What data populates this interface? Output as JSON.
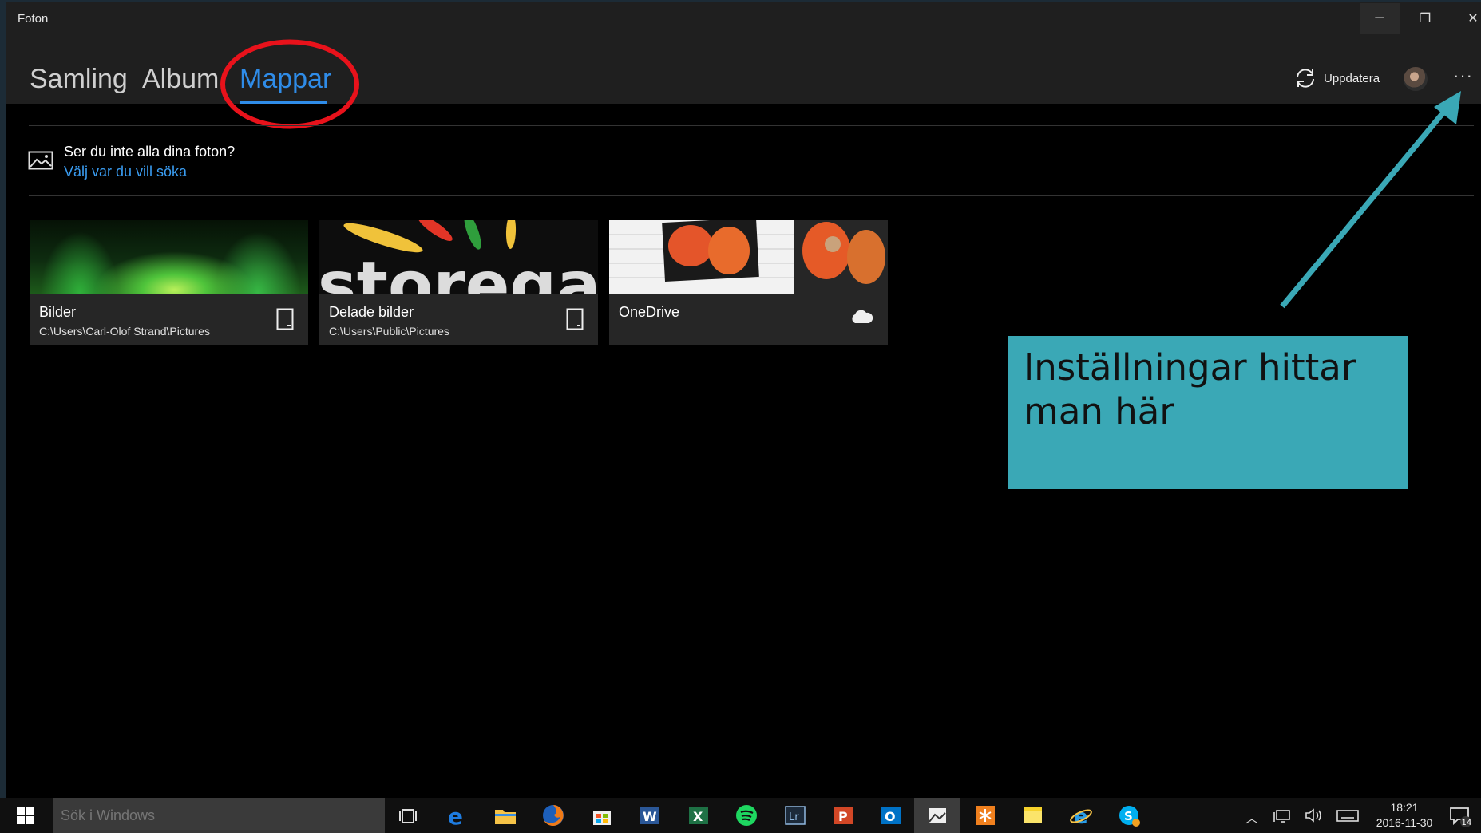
{
  "window": {
    "title": "Foton",
    "minimize_label": "─",
    "maximize_label": "❐",
    "close_label": "✕"
  },
  "nav": {
    "tabs": [
      {
        "label": "Samling"
      },
      {
        "label": "Album"
      },
      {
        "label": "Mappar"
      }
    ],
    "active_tab": "Mappar",
    "refresh_label": "Uppdatera",
    "more_label": "···"
  },
  "notice": {
    "question": "Ser du inte alla dina foton?",
    "link": "Välj var du vill söka"
  },
  "folders": [
    {
      "name": "Bilder",
      "path": "C:\\Users\\Carl-Olof Strand\\Pictures",
      "icon": "device-icon"
    },
    {
      "name": "Delade bilder",
      "path": "C:\\Users\\Public\\Pictures",
      "icon": "device-icon"
    },
    {
      "name": "OneDrive",
      "path": "",
      "icon": "cloud-icon"
    }
  ],
  "thumbnail_text": {
    "storegate": "storegate"
  },
  "callout": {
    "text": "Inställningar hittar man här"
  },
  "taskbar": {
    "search_placeholder": "Sök i Windows",
    "time": "18:21",
    "date": "2016-11-30",
    "notification_count": "14"
  },
  "colors": {
    "accent": "#2f8ce8",
    "callout": "#3aa8b6",
    "highlight_ring": "#e8121b"
  }
}
